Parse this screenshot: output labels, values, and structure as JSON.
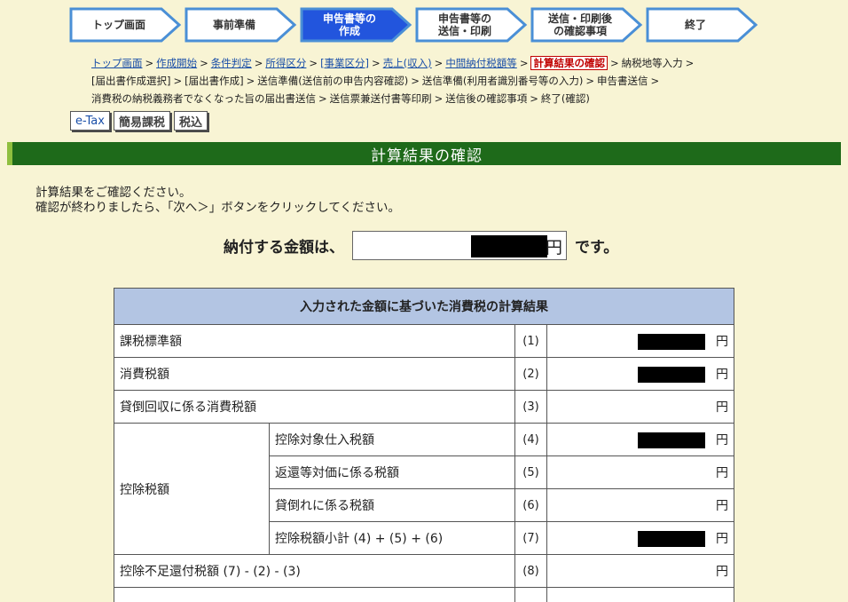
{
  "steps": [
    {
      "label": "トップ画面"
    },
    {
      "label": "事前準備"
    },
    {
      "label": "申告書等の\n作成"
    },
    {
      "label": "申告書等の\n送信・印刷"
    },
    {
      "label": "送信・印刷後\nの確認事項"
    },
    {
      "label": "終了"
    }
  ],
  "breadcrumb": {
    "items": [
      {
        "label": "トップ画面",
        "type": "link"
      },
      {
        "label": "作成開始",
        "type": "link"
      },
      {
        "label": "条件判定",
        "type": "link"
      },
      {
        "label": "所得区分",
        "type": "link"
      },
      {
        "label": "[事業区分]",
        "type": "link"
      },
      {
        "label": "売上(収入)",
        "type": "link"
      },
      {
        "label": "中間納付税額等",
        "type": "link"
      },
      {
        "label": "計算結果の確認",
        "type": "current"
      },
      {
        "label": "納税地等入力",
        "type": "plain"
      },
      {
        "label": "[届出書作成選択]",
        "type": "plain"
      },
      {
        "label": "[届出書作成]",
        "type": "plain"
      },
      {
        "label": "送信準備(送信前の申告内容確認)",
        "type": "plain"
      },
      {
        "label": "送信準備(利用者識別番号等の入力)",
        "type": "plain"
      },
      {
        "label": "申告書送信",
        "type": "plain"
      },
      {
        "label": "消費税の納税義務者でなくなった旨の届出書送信",
        "type": "plain"
      },
      {
        "label": "送信票兼送付書等印刷",
        "type": "plain"
      },
      {
        "label": "送信後の確認事項",
        "type": "plain"
      },
      {
        "label": "終了(確認)",
        "type": "plain"
      }
    ],
    "separator": ">"
  },
  "mini_buttons": {
    "etax": "e-Tax",
    "simple": "簡易課税",
    "tax_inclusive": "税込"
  },
  "title": "計算結果の確認",
  "instructions": {
    "line1": "計算結果をご確認ください。",
    "line2": "確認が終わりましたら、「次へ＞」ボタンをクリックしてください。"
  },
  "payment": {
    "lead": "納付する金額は、",
    "unit": "円",
    "tail": "です。"
  },
  "table": {
    "header": "入力された金額に基づいた消費税の計算結果",
    "unit": "円",
    "group_label": "控除税額",
    "rows": [
      {
        "label": "課税標準額",
        "num": "(1)"
      },
      {
        "label": "消費税額",
        "num": "(2)"
      },
      {
        "label": "貸倒回収に係る消費税額",
        "num": "(3)"
      },
      {
        "label": "控除対象仕入税額",
        "num": "(4)"
      },
      {
        "label": "返還等対価に係る税額",
        "num": "(5)"
      },
      {
        "label": "貸倒れに係る税額",
        "num": "(6)"
      },
      {
        "label": "控除税額小計 (4) + (5) + (6)",
        "num": "(7)"
      },
      {
        "label": "控除不足還付税額 (7) - (2) - (3)",
        "num": "(8)"
      }
    ]
  },
  "colors": {
    "background": "#f8f4d4",
    "step_active": "#2255dd",
    "step_border": "#4a8fd6",
    "title_bar": "#1e6a1a",
    "table_header": "#b3c5e3",
    "current_crumb": "#c00000"
  }
}
